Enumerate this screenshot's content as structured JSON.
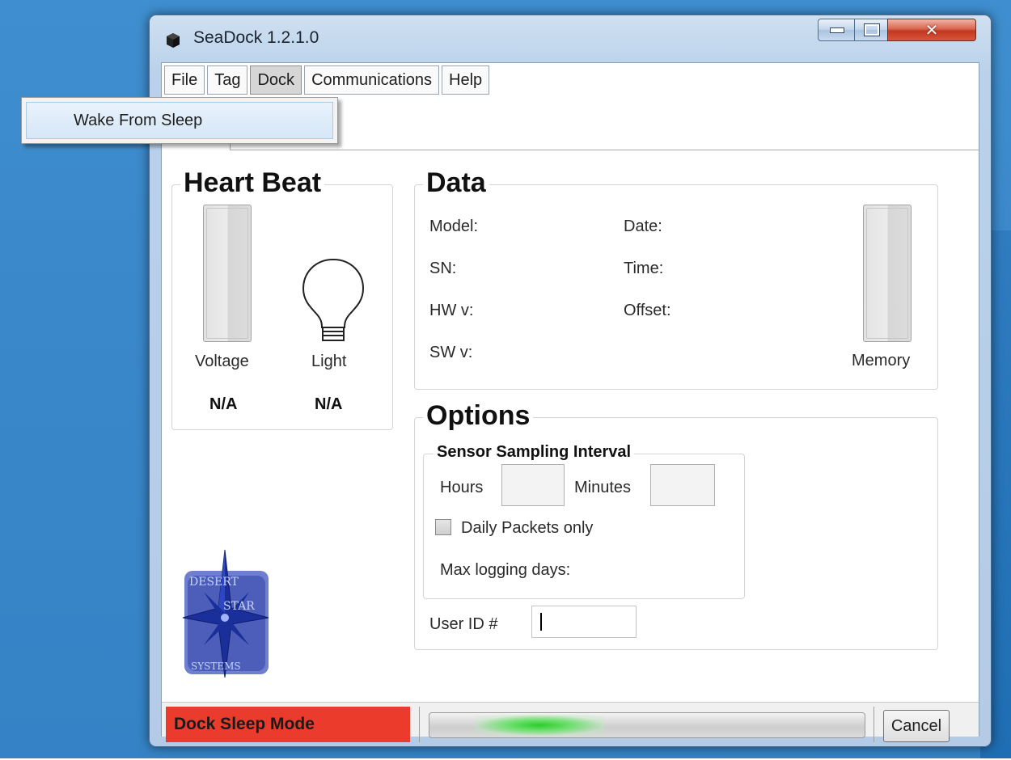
{
  "window": {
    "title": "SeaDock 1.2.1.0"
  },
  "menu": {
    "items": [
      {
        "label": "File"
      },
      {
        "label": "Tag"
      },
      {
        "label": "Dock"
      },
      {
        "label": "Communications"
      },
      {
        "label": "Help"
      }
    ],
    "active_item": "Dock",
    "dropdown": [
      "Wake From Sleep"
    ]
  },
  "heart_beat": {
    "title": "Heart Beat",
    "voltage_label": "Voltage",
    "voltage_value": "N/A",
    "light_label": "Light",
    "light_value": "N/A"
  },
  "data_panel": {
    "title": "Data",
    "model_label": "Model:",
    "sn_label": "SN:",
    "hw_label": "HW v:",
    "sw_label": "SW v:",
    "date_label": "Date:",
    "time_label": "Time:",
    "offset_label": "Offset:",
    "memory_label": "Memory"
  },
  "options": {
    "title": "Options",
    "sampling_title": "Sensor Sampling Interval",
    "hours_label": "Hours",
    "hours_value": "",
    "minutes_label": "Minutes",
    "minutes_value": "",
    "daily_packets_label": "Daily Packets only",
    "daily_packets_checked": false,
    "max_logging_label": "Max logging days:",
    "user_id_label": "User ID #",
    "user_id_value": ""
  },
  "logo": {
    "text": "Desert Star Systems"
  },
  "status": {
    "mode": "Dock Sleep Mode",
    "mode_color": "#ea3b2c",
    "cancel_label": "Cancel"
  },
  "colors": {
    "desktop": "#3a87c9",
    "progress_glow": "#2ccc2c"
  }
}
